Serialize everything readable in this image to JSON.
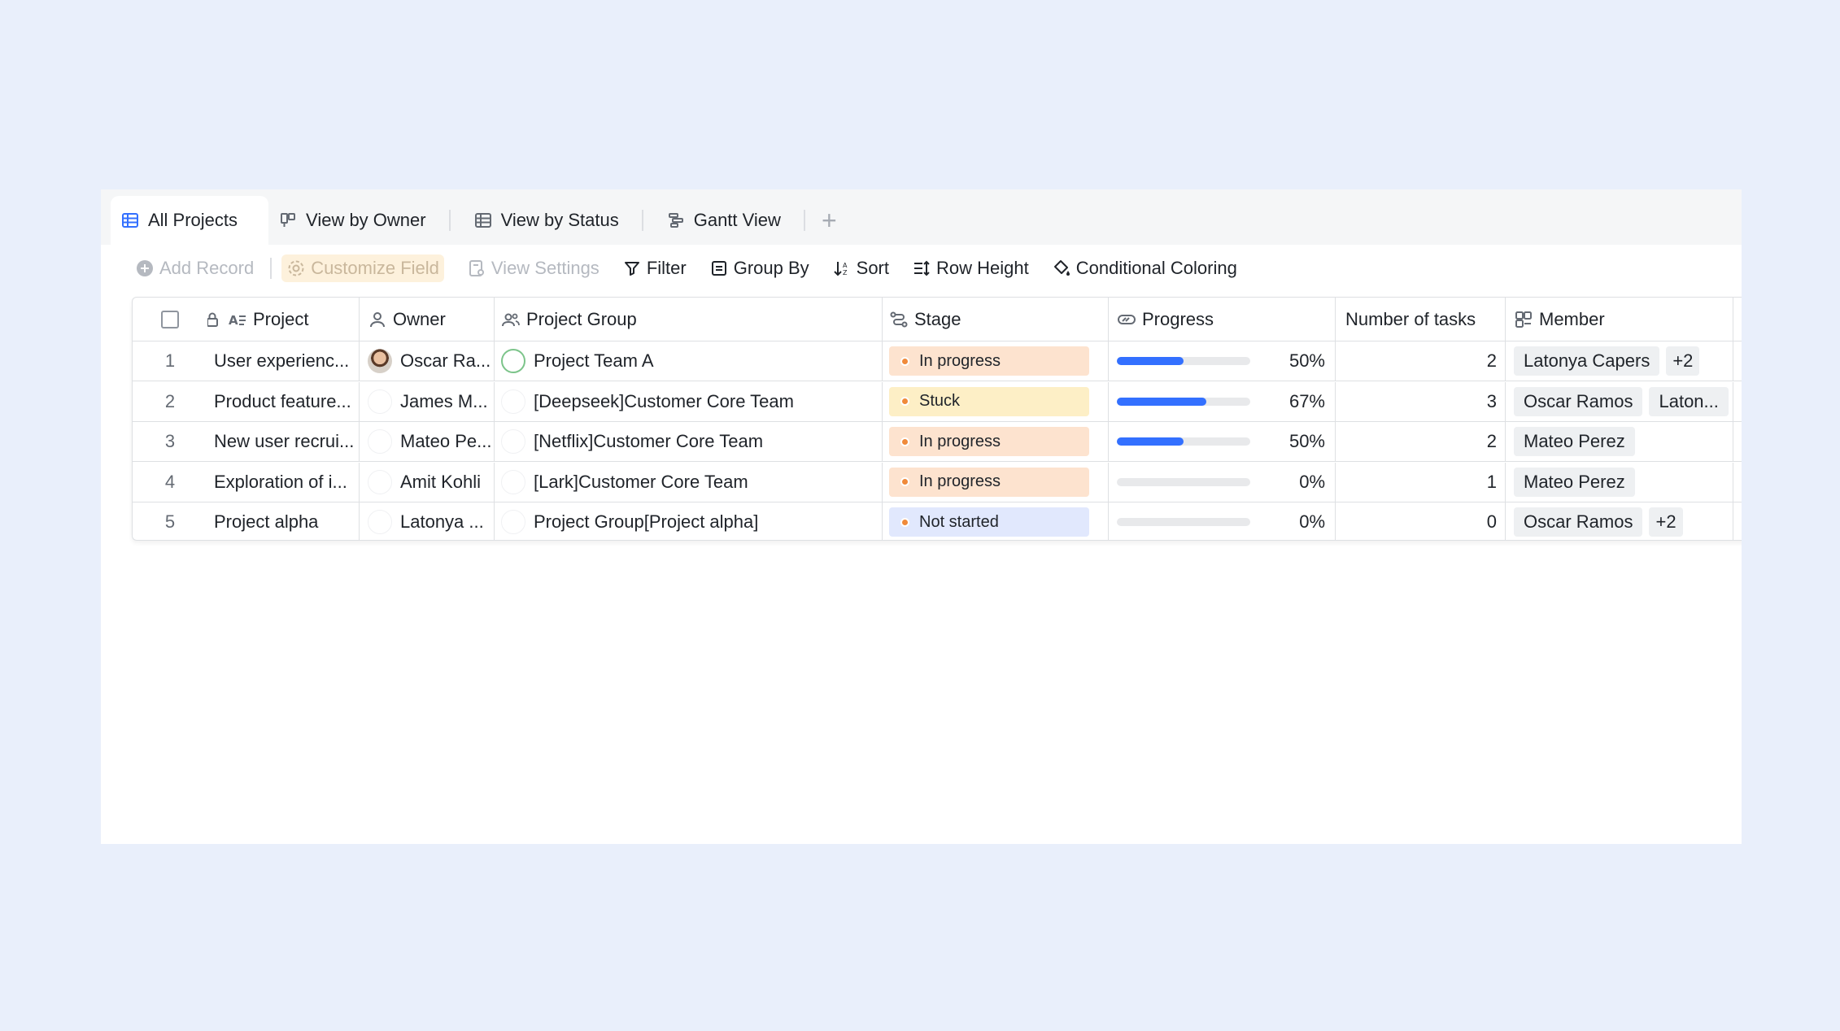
{
  "tabs": [
    {
      "label": "All Projects",
      "icon": "grid-table-icon",
      "active": true
    },
    {
      "label": "View by Owner",
      "icon": "kanban-icon",
      "active": false
    },
    {
      "label": "View by Status",
      "icon": "grid-table-icon",
      "active": false
    },
    {
      "label": "Gantt View",
      "icon": "gantt-icon",
      "active": false
    }
  ],
  "tab_add_label": "+",
  "toolbar": {
    "add_record": "Add Record",
    "customize_field": "Customize Field",
    "view_settings": "View Settings",
    "filter": "Filter",
    "group_by": "Group By",
    "sort": "Sort",
    "row_height": "Row Height",
    "conditional_coloring": "Conditional Coloring"
  },
  "columns": {
    "project": "Project",
    "owner": "Owner",
    "project_group": "Project Group",
    "stage": "Stage",
    "progress": "Progress",
    "number_of_tasks": "Number of tasks",
    "member": "Member"
  },
  "rows": [
    {
      "index": "1",
      "project": "User experienc...",
      "owner": "Oscar Ra...",
      "group": "Project Team A",
      "stage": "In progress",
      "progress": 0.5,
      "progress_label": "50%",
      "tasks": "2",
      "members": [
        "Latonya Capers",
        "+2"
      ]
    },
    {
      "index": "2",
      "project": "Product feature...",
      "owner": "James M...",
      "group": "[Deepseek]Customer Core Team",
      "stage": "Stuck",
      "progress": 0.67,
      "progress_label": "67%",
      "tasks": "3",
      "members": [
        "Oscar Ramos",
        "Laton..."
      ]
    },
    {
      "index": "3",
      "project": "New user recrui...",
      "owner": "Mateo Pe...",
      "group": "[Netflix]Customer Core Team",
      "stage": "In progress",
      "progress": 0.5,
      "progress_label": "50%",
      "tasks": "2",
      "members": [
        "Mateo Perez"
      ]
    },
    {
      "index": "4",
      "project": "Exploration of i...",
      "owner": "Amit Kohli",
      "group": "[Lark]Customer Core Team",
      "stage": "In progress",
      "progress": 0,
      "progress_label": "0%",
      "tasks": "1",
      "members": [
        "Mateo Perez"
      ]
    },
    {
      "index": "5",
      "project": "Project alpha",
      "owner": "Latonya ...",
      "group": "Project Group[Project alpha]",
      "stage": "Not started",
      "progress": 0,
      "progress_label": "0%",
      "tasks": "0",
      "members": [
        "Oscar Ramos",
        "+2"
      ]
    }
  ],
  "colors": {
    "accent": "#3370ff",
    "stage_in_progress_bg": "#fde3cf",
    "stage_stuck_bg": "#fdefc6",
    "stage_not_started_bg": "#e1e8fd",
    "stage_dot": "#f08a3a"
  }
}
